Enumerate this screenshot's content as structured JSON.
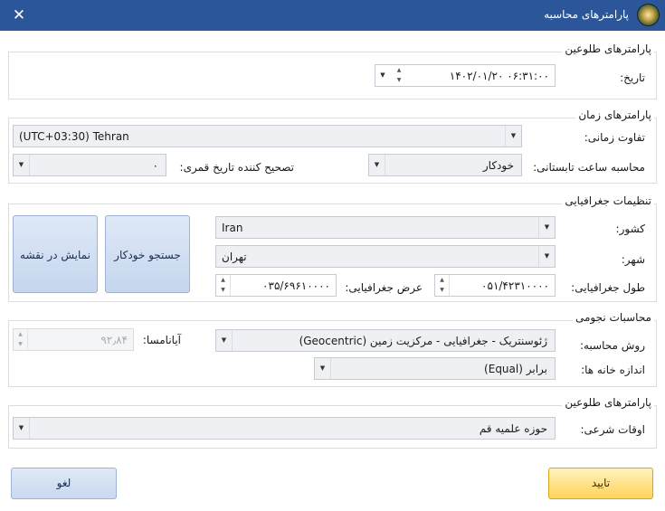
{
  "window": {
    "title": "پارامترهای محاسبه",
    "close_icon": "✕"
  },
  "sunrise_params": {
    "label": "پارامترهای طلوعین",
    "date_label": "تاریخ:",
    "date_value": "۱۴۰۲/۰۱/۲۰ ۰۶:۳۱:۰۰"
  },
  "time_params": {
    "label": "پارامترهای زمان",
    "timezone_label": "تفاوت زمانی:",
    "timezone_value": "(UTC+03:30) Tehran",
    "dst_label": "محاسبه ساعت تابستانی:",
    "dst_value": "خودکار",
    "lunar_correction_label": "تصحیح کننده تاریخ قمری:",
    "lunar_correction_value": "۰"
  },
  "geo_settings": {
    "label": "تنظیمات جغرافیایی",
    "country_label": "کشور:",
    "country_value": "Iran",
    "city_label": "شهر:",
    "city_value": "تهران",
    "longitude_label": "طول جغرافیایی:",
    "longitude_value": "۰۵۱/۴۲۳۱۰۰۰۰",
    "latitude_label": "عرض جغرافیایی:",
    "latitude_value": "۰۳۵/۶۹۶۱۰۰۰۰",
    "auto_search_button": "جستجو خودکار",
    "show_map_button": "نمایش در نقشه"
  },
  "astro_calc": {
    "label": "محاسبات نجومی",
    "method_label": "روش محاسبه:",
    "method_value": "ژئوسنتریک - جغرافیایی - مرکزیت زمین (Geocentric)",
    "ayanamsa_label": "آیانامسا:",
    "ayanamsa_value": "۹۲٫۸۴",
    "house_size_label": "اندازه خانه ها:",
    "house_size_value": "برابر (Equal)"
  },
  "prayer_params": {
    "label": "پارامترهای طلوعین",
    "religious_times_label": "اوقات شرعی:",
    "religious_times_value": "حوزه علمیه قم"
  },
  "buttons": {
    "ok": "تایید",
    "cancel": "لغو"
  },
  "glyphs": {
    "dropdown": "▼",
    "up": "▲",
    "down": "▼"
  },
  "colors": {
    "titlebar": "#2b579a",
    "ok_button": "#ffd35a",
    "secondary_button": "#c5d6ee"
  }
}
